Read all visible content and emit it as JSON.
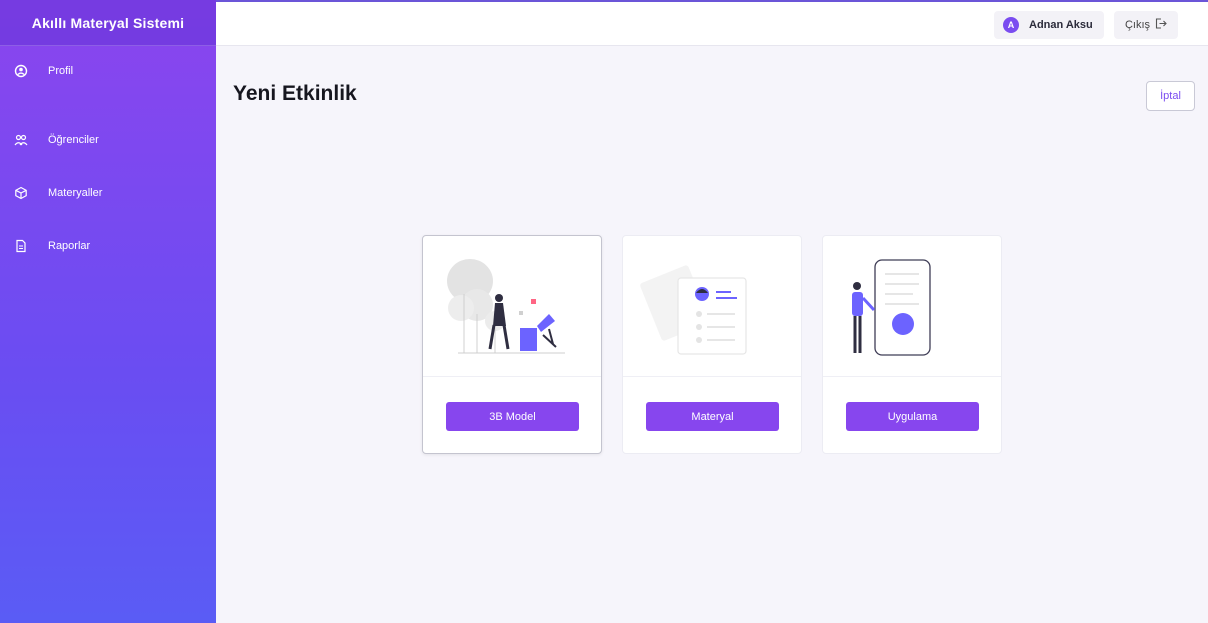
{
  "app": {
    "title": "Akıllı Materyal Sistemi"
  },
  "sidebar": {
    "items": [
      {
        "label": "Profil",
        "icon": "user-circle-icon"
      },
      {
        "label": "Öğrenciler",
        "icon": "users-icon"
      },
      {
        "label": "Materyaller",
        "icon": "cube-icon"
      },
      {
        "label": "Raporlar",
        "icon": "document-icon"
      }
    ]
  },
  "topbar": {
    "avatar_letter": "A",
    "user_name": "Adnan Aksu",
    "logout_label": "Çıkış",
    "logout_icon": "logout-icon"
  },
  "main": {
    "title": "Yeni Etkinlik",
    "cancel_label": "İptal",
    "cards": [
      {
        "button": "3B Model",
        "illustration": "3d-model-illustration"
      },
      {
        "button": "Materyal",
        "illustration": "material-document-illustration"
      },
      {
        "button": "Uygulama",
        "illustration": "mobile-app-illustration"
      }
    ]
  },
  "colors": {
    "accent": "#8746ee",
    "sidebar_top": "#8b45ee",
    "sidebar_bottom": "#5a5cf5",
    "background": "#f6f5fb"
  }
}
